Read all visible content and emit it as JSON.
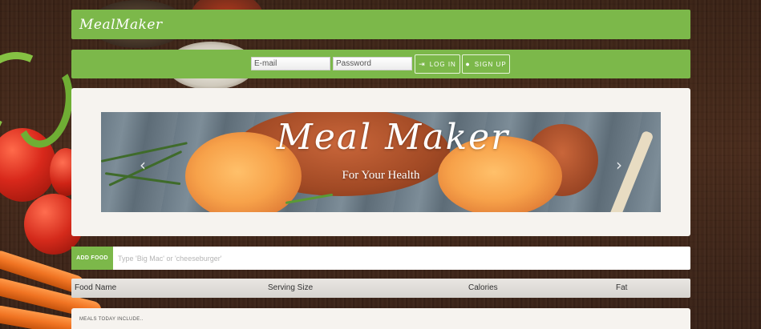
{
  "brand": {
    "logo_text": "MealMaker"
  },
  "auth": {
    "email_placeholder": "E-mail",
    "password_placeholder": "Password",
    "login_label": "LOG IN",
    "login_icon": "sign-in-icon",
    "signup_label": "SIGN UP",
    "signup_icon": "user-icon"
  },
  "hero": {
    "title": "Meal Maker",
    "subtitle": "For Your Health",
    "prev_icon": "‹",
    "next_icon": "›"
  },
  "food_search": {
    "add_label": "ADD FOOD",
    "placeholder": "Type 'Big Mac' or 'cheeseburger'"
  },
  "table": {
    "columns": [
      "Food Name",
      "Serving Size",
      "Calories",
      "Fat"
    ]
  },
  "meals": {
    "title": "MEALS TODAY INCLUDE.."
  },
  "colors": {
    "accent": "#7cb84a",
    "card": "#f6f3ef",
    "wood": "#4a2c1c"
  }
}
